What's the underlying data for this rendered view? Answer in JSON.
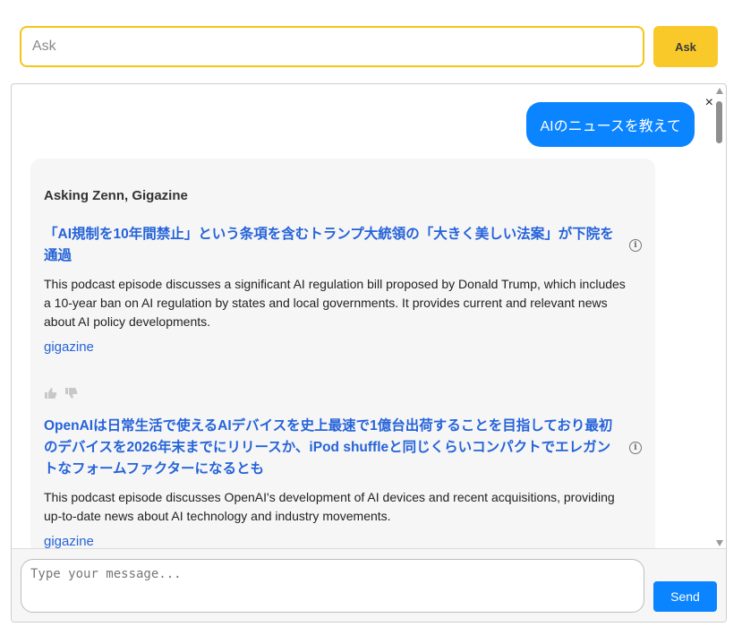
{
  "search": {
    "placeholder": "Ask",
    "button_label": "Ask"
  },
  "chat": {
    "close_symbol": "×",
    "user_message": "AIのニュースを教えて",
    "answer": {
      "asking_label": "Asking Zenn, Gigazine",
      "results": [
        {
          "title": "「AI規制を10年間禁止」という条項を含むトランプ大統領の「大きく美しい法案」が下院を通過",
          "description": "This podcast episode discusses a significant AI regulation bill proposed by Donald Trump, which includes a 10-year ban on AI regulation by states and local governments. It provides current and relevant news about AI policy developments.",
          "source": "gigazine"
        },
        {
          "title": "OpenAIは日常生活で使えるAIデバイスを史上最速で1億台出荷することを目指しており最初のデバイスを2026年末までにリリースか、iPod shuffleと同じくらいコンパクトでエレガントなフォームファクターになるとも",
          "description": "This podcast episode discusses OpenAI's development of AI devices and recent acquisitions, providing up-to-date news about AI technology and industry movements.",
          "source": "gigazine"
        }
      ]
    },
    "composer": {
      "placeholder": "Type your message...",
      "send_label": "Send"
    }
  },
  "icons": {
    "info": "info-circle-icon",
    "thumbs_up": "thumbs-up-icon",
    "thumbs_down": "thumbs-down-icon",
    "close": "close-icon"
  },
  "colors": {
    "accent_yellow": "#f9c92a",
    "link_blue": "#2563d9",
    "bubble_blue": "#0b84ff"
  }
}
